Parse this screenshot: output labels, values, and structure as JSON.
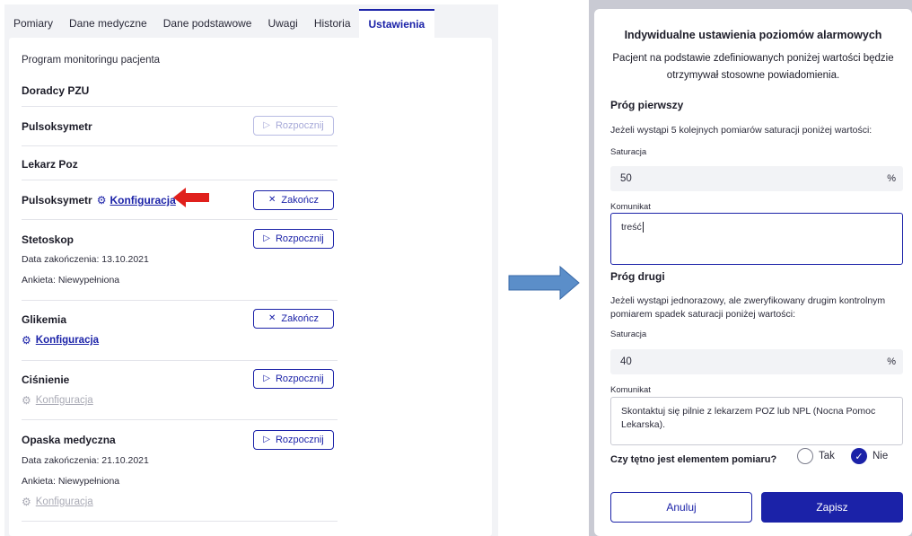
{
  "tabs": [
    {
      "label": "Pomiary"
    },
    {
      "label": "Dane medyczne"
    },
    {
      "label": "Dane podstawowe"
    },
    {
      "label": "Uwagi"
    },
    {
      "label": "Historia"
    },
    {
      "label": "Ustawienia",
      "active": true
    }
  ],
  "settings": {
    "program_title": "Program monitoringu pacjenta",
    "groups": [
      {
        "title": "Doradcy PZU",
        "items": [
          {
            "title": "Pulsoksymetr",
            "button": "Rozpocznij",
            "button_icon": "play-icon",
            "disabled": true
          }
        ]
      },
      {
        "title": "Lekarz Poz",
        "items": [
          {
            "title": "Pulsoksymetr",
            "config": "Konfiguracja",
            "button": "Zakończ",
            "button_icon": "close-icon"
          },
          {
            "title": "Stetoskop",
            "button": "Rozpocznij",
            "button_icon": "play-icon",
            "end_date": "Data zakończenia: 13.10.2021",
            "survey": "Ankieta: Niewypełniona"
          },
          {
            "title": "Glikemia",
            "button": "Zakończ",
            "button_icon": "close-icon",
            "config": "Konfiguracja"
          },
          {
            "title": "Ciśnienie",
            "button": "Rozpocznij",
            "button_icon": "play-icon",
            "config": "Konfiguracja",
            "config_disabled": true
          },
          {
            "title": "Opaska medyczna",
            "button": "Rozpocznij",
            "button_icon": "play-icon",
            "end_date": "Data zakończenia: 21.10.2021",
            "survey": "Ankieta: Niewypełniona",
            "config": "Konfiguracja",
            "config_disabled": true
          }
        ]
      }
    ]
  },
  "icons": {
    "play": "▷",
    "close": "✕",
    "gear": "⚙",
    "check": "✓"
  },
  "colors": {
    "primary": "#1b22a8",
    "annotation_red": "#e0201c",
    "arrow_blue": "#5b8ec9"
  },
  "modal": {
    "title": "Indywidualne ustawienia poziomów alarmowych",
    "subtitle": "Pacjent na podstawie zdefiniowanych poniżej wartości będzie otrzymywał stosowne powiadomienia.",
    "threshold1": {
      "heading": "Próg pierwszy",
      "description": "Jeżeli wystąpi 5 kolejnych pomiarów saturacji poniżej wartości:",
      "sat_label": "Saturacja",
      "sat_value": "50",
      "unit": "%",
      "msg_label": "Komunikat",
      "msg_value": "treść"
    },
    "threshold2": {
      "heading": "Próg drugi",
      "description": "Jeżeli wystąpi jednorazowy, ale zweryfikowany drugim kontrolnym pomiarem spadek saturacji poniżej wartości:",
      "sat_label": "Saturacja",
      "sat_value": "40",
      "unit": "%",
      "msg_label": "Komunikat",
      "msg_value": "Skontaktuj się pilnie z lekarzem POZ lub NPL (Nocna Pomoc Lekarska)."
    },
    "pulse_question": "Czy tętno jest elementem pomiaru?",
    "option_yes": "Tak",
    "option_no": "Nie",
    "selected": "Nie",
    "cancel": "Anuluj",
    "save": "Zapisz"
  }
}
